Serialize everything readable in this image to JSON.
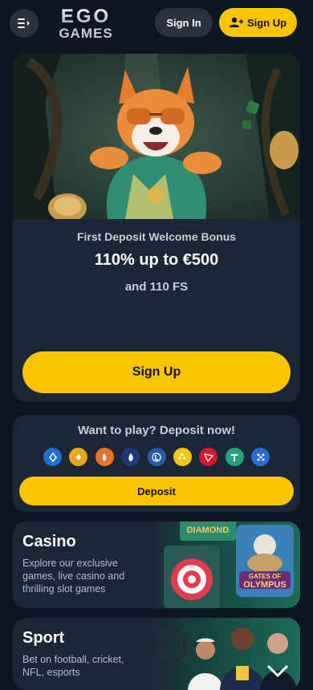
{
  "header": {
    "logo_line1": "EGO",
    "logo_line2": "GAMES",
    "signin_label": "Sign In",
    "signup_label": "Sign Up"
  },
  "promo": {
    "subtitle": "First Deposit Welcome Bonus",
    "title": "110% up to €500",
    "extra": "and 110 FS",
    "signup_label": "Sign Up"
  },
  "deposit": {
    "title": "Want to play? Deposit now!",
    "button_label": "Deposit",
    "coins": [
      {
        "icon": "bitcoin-blue-icon",
        "color": "#1d6fd1"
      },
      {
        "icon": "binance-icon",
        "color": "#e6a91b"
      },
      {
        "icon": "fire-token-icon",
        "color": "#e8722c"
      },
      {
        "icon": "flame-token-icon",
        "color": "#223a7a"
      },
      {
        "icon": "litecoin-icon",
        "color": "#2a5ba8"
      },
      {
        "icon": "dogecoin-icon",
        "color": "#f3c51c"
      },
      {
        "icon": "tron-icon",
        "color": "#d7192f"
      },
      {
        "icon": "tether-icon",
        "color": "#26a17b"
      },
      {
        "icon": "ripple-icon",
        "color": "#2a6bd6"
      }
    ]
  },
  "categories": {
    "casino": {
      "title": "Casino",
      "description": "Explore our exclusive games, live casino and thrilling slot games",
      "art_text_1": "DIAMOND",
      "art_text_2": "GATES OF",
      "art_text_3": "OLYMPUS"
    },
    "sport": {
      "title": "Sport",
      "description": "Bet on football, cricket, NFL, esports"
    }
  },
  "colors": {
    "accent": "#f9c400",
    "background": "#0f1622",
    "card": "#1b2636"
  }
}
